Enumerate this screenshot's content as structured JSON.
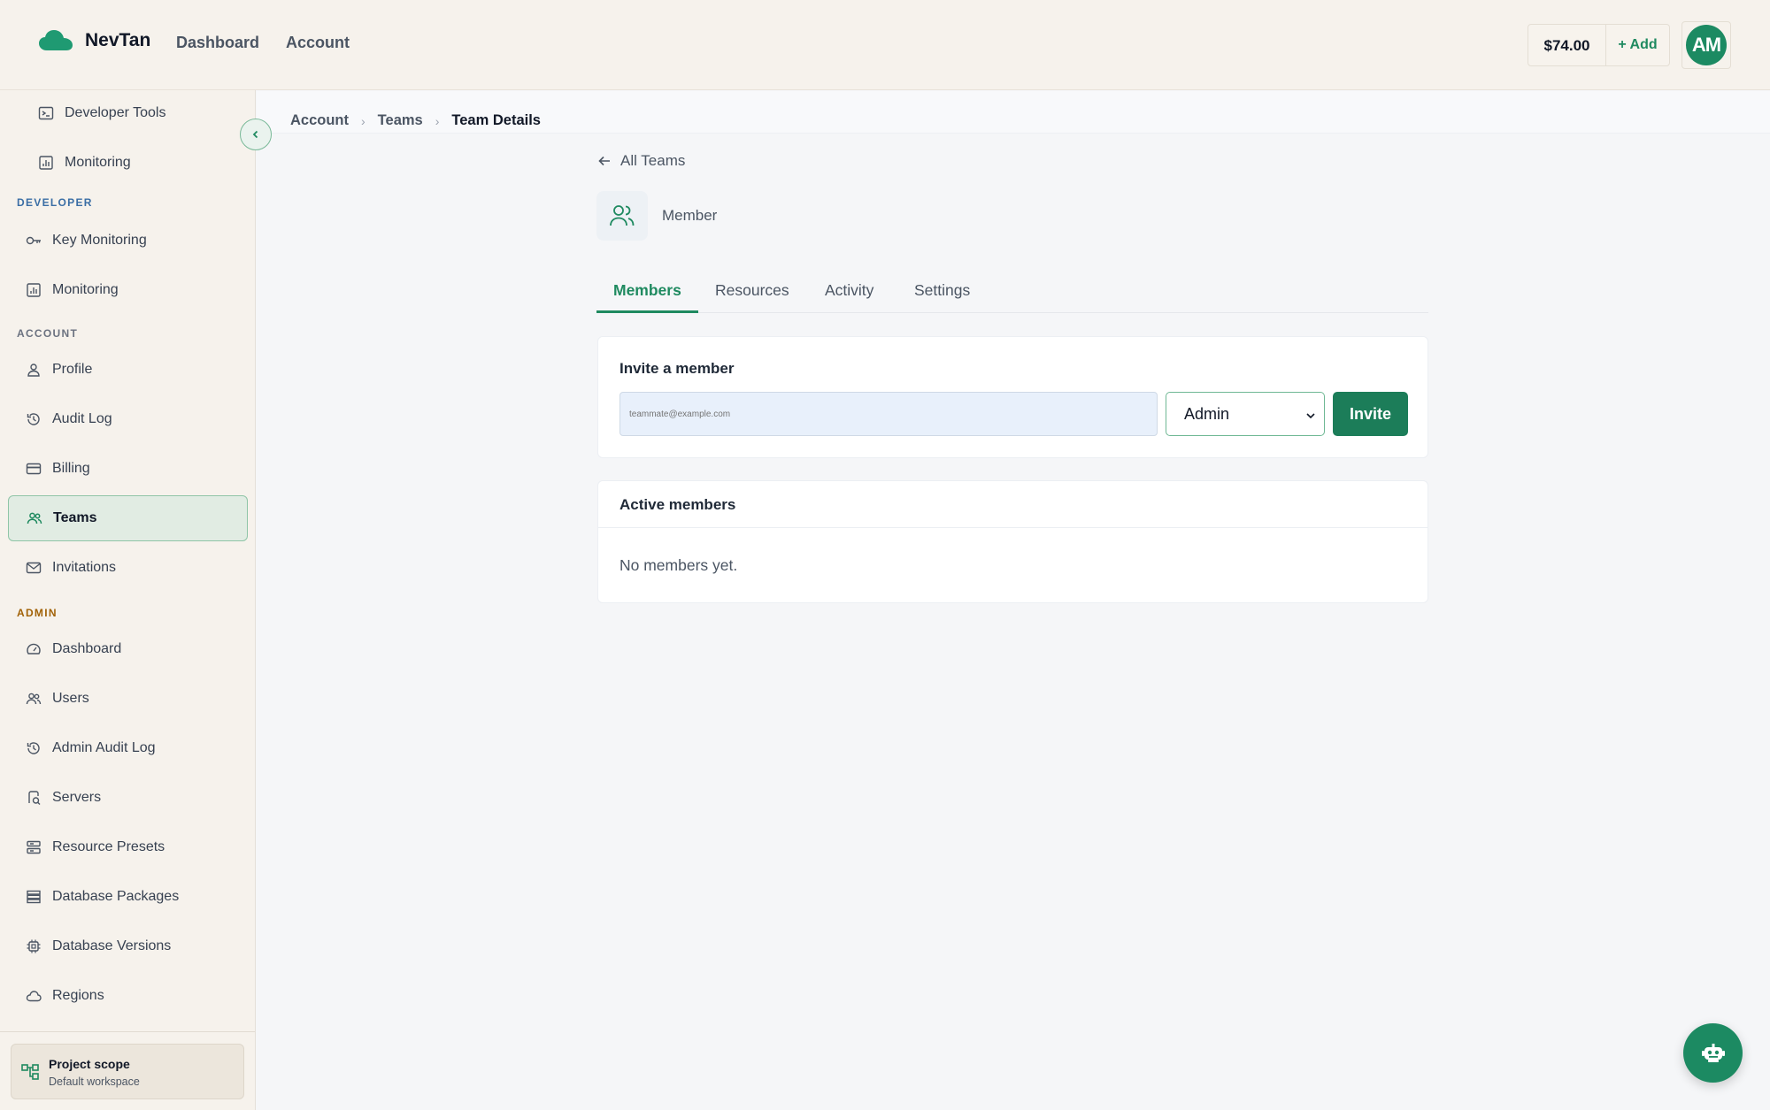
{
  "header": {
    "brand": "NevTan",
    "nav": [
      "Dashboard",
      "Account"
    ],
    "balance": "$74.00",
    "add_label": "+ Add",
    "avatar_initials": "AM"
  },
  "sidebar": {
    "top_items": [
      {
        "label": "Developer Tools",
        "icon": "terminal-icon"
      },
      {
        "label": "Monitoring",
        "icon": "chart-icon"
      }
    ],
    "sections": [
      {
        "title": "DEVELOPER",
        "items": [
          {
            "label": "Key Monitoring",
            "icon": "key-icon"
          },
          {
            "label": "Monitoring",
            "icon": "chart-icon"
          }
        ]
      },
      {
        "title": "ACCOUNT",
        "items": [
          {
            "label": "Profile",
            "icon": "user-icon"
          },
          {
            "label": "Audit Log",
            "icon": "history-icon"
          },
          {
            "label": "Billing",
            "icon": "credit-card-icon"
          },
          {
            "label": "Teams",
            "icon": "users-icon",
            "active": true
          },
          {
            "label": "Invitations",
            "icon": "mail-icon"
          }
        ]
      },
      {
        "title": "ADMIN",
        "items": [
          {
            "label": "Dashboard",
            "icon": "gauge-icon"
          },
          {
            "label": "Users",
            "icon": "users-icon"
          },
          {
            "label": "Admin Audit Log",
            "icon": "history-icon"
          },
          {
            "label": "Servers",
            "icon": "server-search-icon"
          },
          {
            "label": "Resource Presets",
            "icon": "preset-icon"
          },
          {
            "label": "Database Packages",
            "icon": "database-list-icon"
          },
          {
            "label": "Database Versions",
            "icon": "chip-icon"
          },
          {
            "label": "Regions",
            "icon": "cloud-icon"
          }
        ]
      }
    ],
    "scope": {
      "title": "Project scope",
      "subtitle": "Default workspace"
    }
  },
  "breadcrumb": [
    "Account",
    "Teams",
    "Team Details"
  ],
  "main": {
    "back_label": "All Teams",
    "team_role": "Member",
    "tabs": [
      "Members",
      "Resources",
      "Activity",
      "Settings"
    ],
    "active_tab": "Members",
    "invite": {
      "title": "Invite a member",
      "email_placeholder": "teammate@example.com",
      "role_value": "Admin",
      "button_label": "Invite"
    },
    "members": {
      "title": "Active members",
      "empty_text": "No members yet."
    }
  },
  "colors": {
    "brand": "#1c8a62",
    "header_bg": "#f6f2ec",
    "page_bg": "#f5f6f8"
  }
}
